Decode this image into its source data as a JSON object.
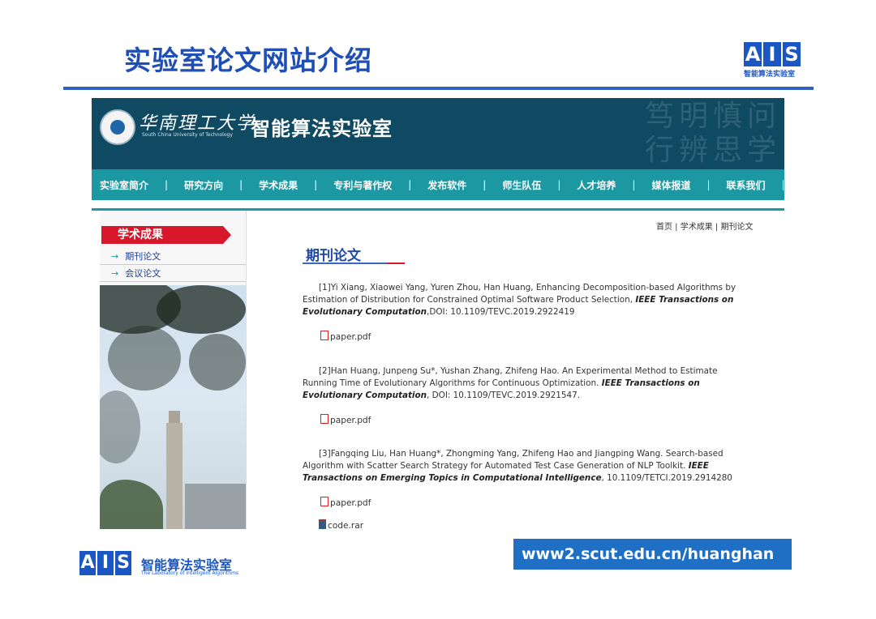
{
  "slide": {
    "title": "实验室论文网站介绍",
    "url": "www2.scut.edu.cn/huanghan",
    "logo_mark": [
      "A",
      "I",
      "S"
    ],
    "logo_caption": "智能算法实验室",
    "logo_bottom_name": "智能算法实验室",
    "logo_bottom_en": "The Laboratory of Intelligent Algorithms"
  },
  "site": {
    "university_name": "华南理工大学",
    "university_en": "South China University of Technology",
    "lab_name": "智能算法实验室",
    "calligraphy": "笃明慎问 行辨思学",
    "nav": [
      "实验室简介",
      "研究方向",
      "学术成果",
      "专利与著作权",
      "发布软件",
      "师生队伍",
      "人才培养",
      "媒体报道",
      "联系我们"
    ],
    "nav_separator": "|",
    "breadcrumb": "首页 | 学术成果 | 期刊论文",
    "sidebar": {
      "heading": "学术成果",
      "arrow": "→",
      "items": [
        "期刊论文",
        "会议论文"
      ]
    },
    "section_title": "期刊论文",
    "papers": [
      {
        "text": "[1]Yi Xiang, Xiaowei Yang, Yuren Zhou, Han Huang, Enhancing Decomposition-based Algorithms by Estimation of Distribution for Constrained Optimal Software Product Selection, ",
        "venue": "IEEE Transactions on Evolutionary Computation",
        "doi": ",DOI: 10.1109/TEVC.2019.2922419",
        "files": [
          "paper.pdf"
        ]
      },
      {
        "text": "[2]Han Huang, Junpeng Su*, Yushan Zhang, Zhifeng Hao. An Experimental Method to Estimate Running Time of Evolutionary Algorithms for Continuous Optimization. ",
        "venue": "IEEE Transactions on Evolutionary Computation",
        "doi": ", DOI: 10.1109/TEVC.2019.2921547.",
        "files": [
          "paper.pdf"
        ]
      },
      {
        "text": "[3]Fangqing Liu, Han Huang*, Zhongming Yang, Zhifeng Hao and Jiangping Wang. Search-based Algorithm with Scatter Search Strategy for Automated Test Case Generation of NLP Toolkit. ",
        "venue": "IEEE Transactions on Emerging Topics in Computational Intelligence",
        "doi": ", 10.1109/TETCI.2019.2914280",
        "files": [
          "paper.pdf",
          "code.rar"
        ]
      }
    ]
  }
}
